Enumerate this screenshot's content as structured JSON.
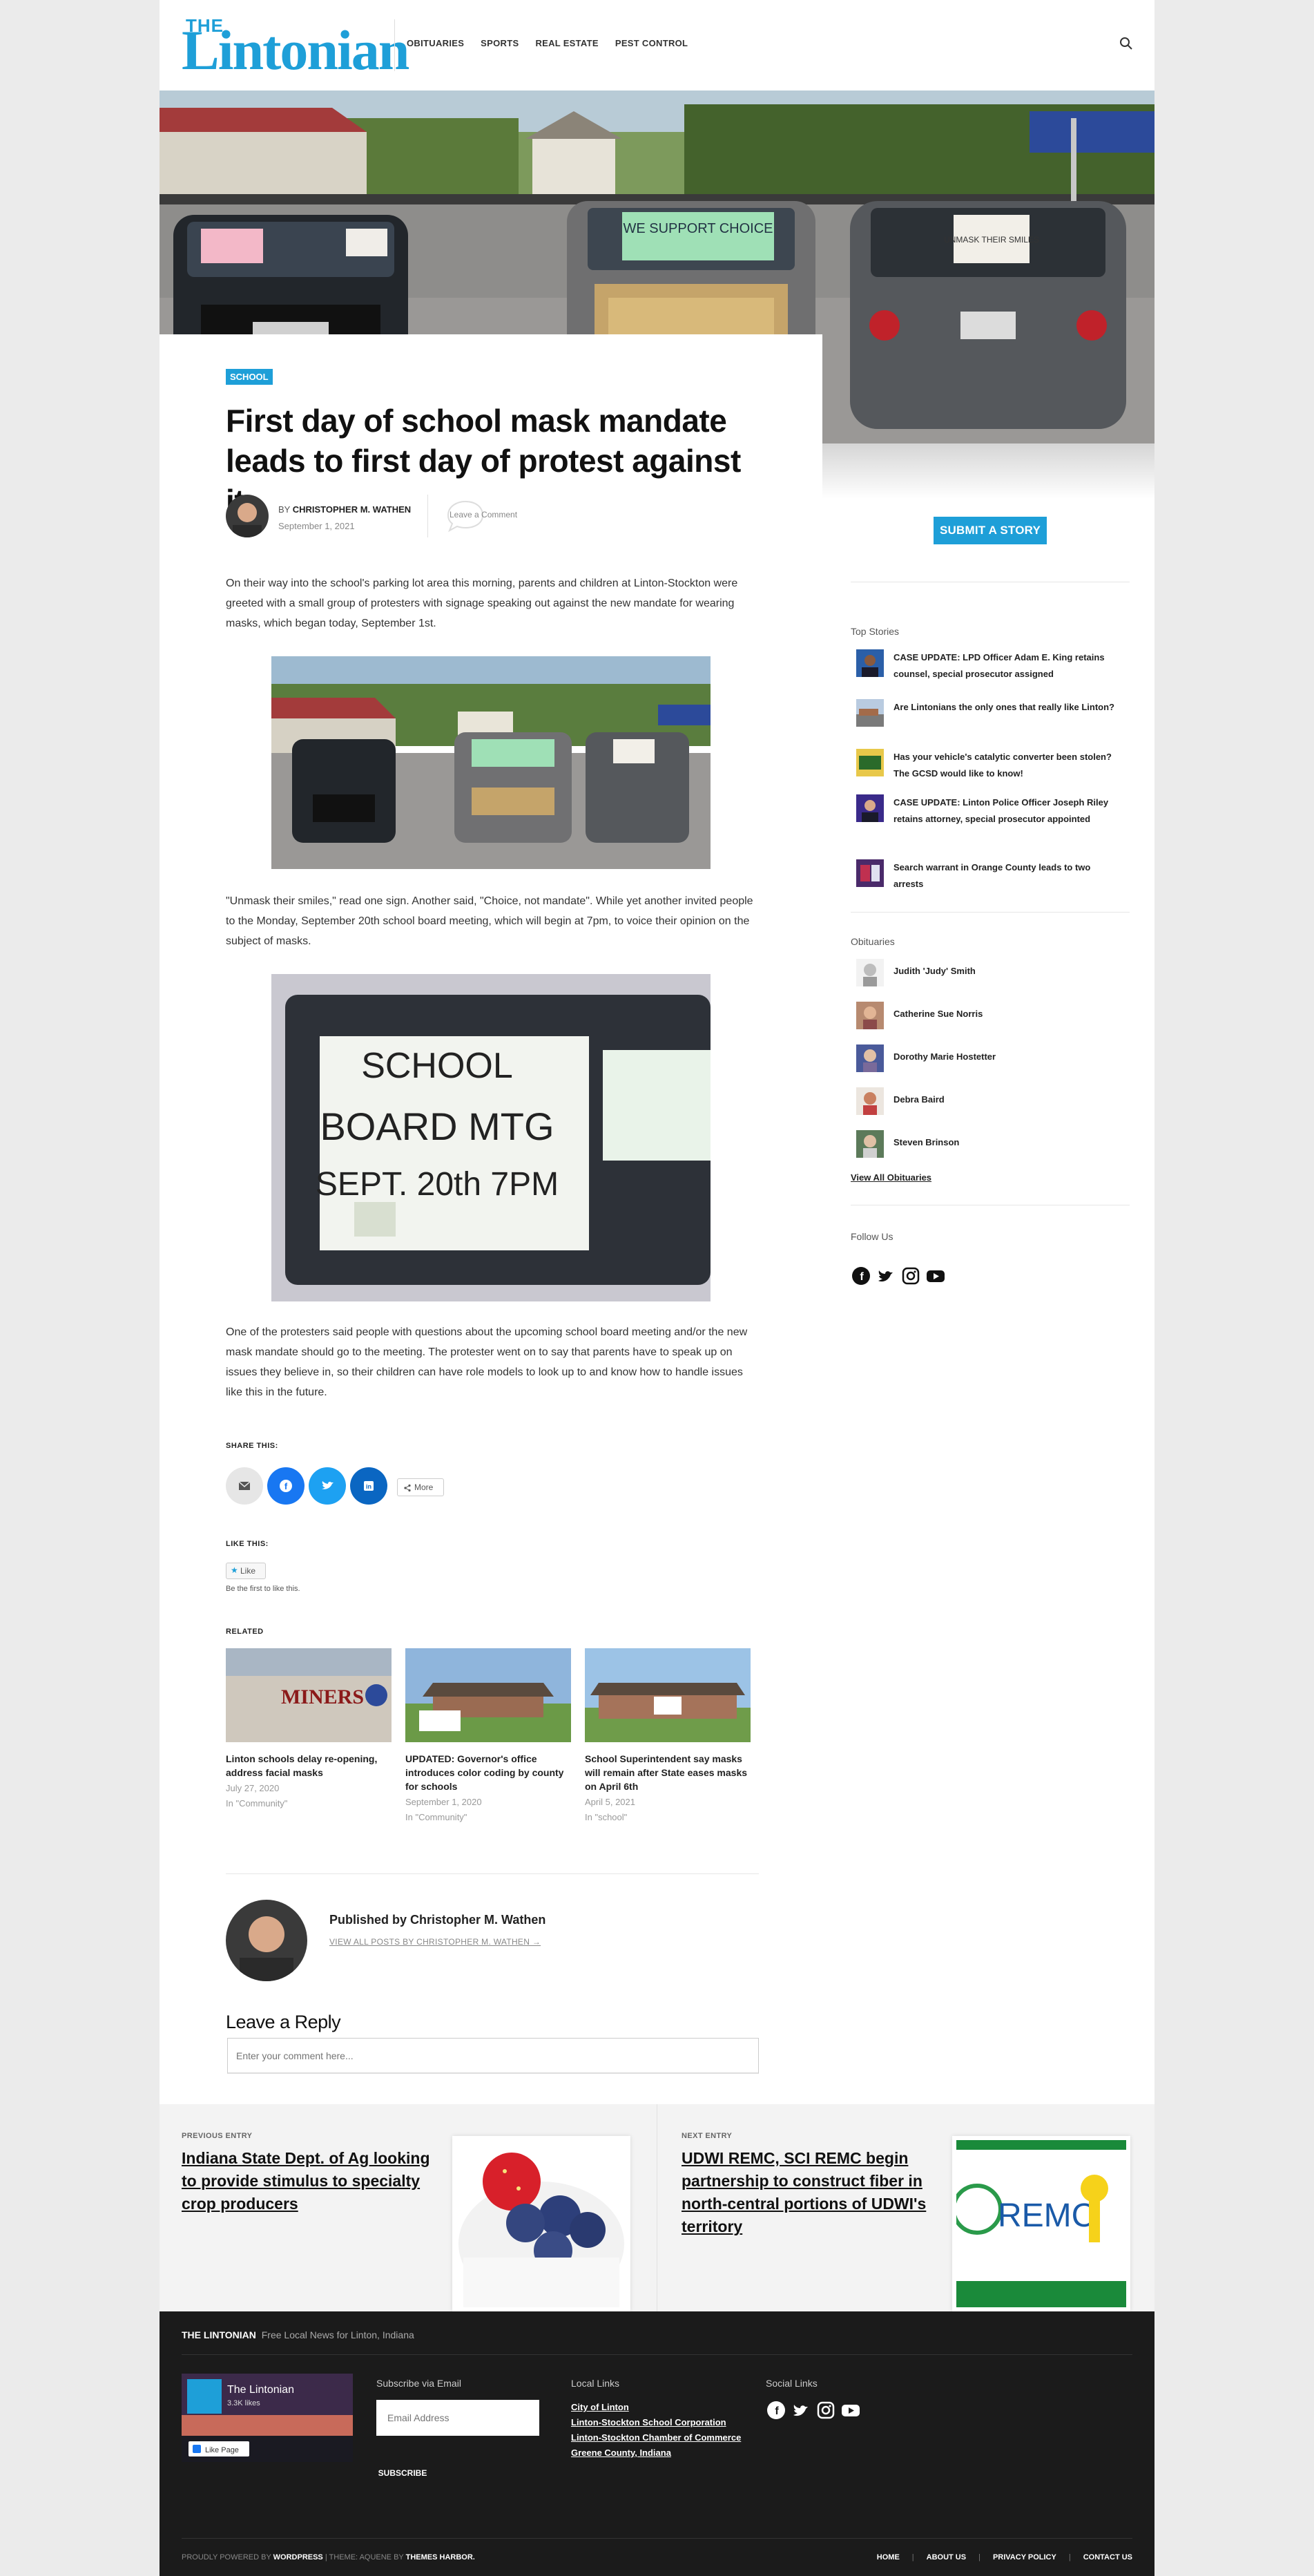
{
  "site": {
    "logo_small": "THE",
    "logo_name": "Lintonian",
    "nav": [
      "OBITUARIES",
      "SPORTS",
      "REAL ESTATE",
      "PEST CONTROL"
    ]
  },
  "hero": {
    "signs": [
      "UNMASK THEIR SMILES",
      "WE SUPPORT CHOICE"
    ]
  },
  "article": {
    "category": "SCHOOL",
    "title": "First day of school mask mandate leads to first day of protest against it",
    "by_prefix": "BY",
    "author": "CHRISTOPHER M. WATHEN",
    "date": "September 1, 2021",
    "comment_link": "Leave a Comment",
    "p1": "On their way into the school's parking lot area this morning, parents and children at Linton-Stockton were greeted with a small group of protesters with signage speaking out against the new mandate for wearing masks, which began today, September 1st.",
    "p2": "\"Unmask their smiles,\" read one sign. Another said, \"Choice, not mandate\". While yet another invited people to the Monday, September 20th school board meeting, which will begin at 7pm, to voice their opinion on the subject of masks.",
    "image2_sign": [
      "SCHOOL",
      "BOARD MTG",
      "SEPT. 20th 7PM"
    ],
    "p3": "One of the protesters said people with questions about the upcoming school board meeting and/or the new mask mandate should go to the meeting. The protester went on to say that parents have to speak up on issues they believe in, so their children can have role models to look up to and know how to handle issues like this in the future.",
    "share_label": "SHARE THIS:",
    "more_label": "More",
    "like_label": "LIKE THIS:",
    "like_button": "Like",
    "like_first": "Be the first to like this.",
    "related_label": "RELATED",
    "related": [
      {
        "title": "Linton schools delay re-opening, address facial masks",
        "date": "July 27, 2020",
        "category": "In \"Community\"",
        "thumb_text": "MINERS"
      },
      {
        "title": "UPDATED: Governor's office introduces color coding by county for schools",
        "date": "September 1, 2020",
        "category": "In \"Community\""
      },
      {
        "title": "School Superintendent say masks will remain after State eases masks on April 6th",
        "date": "April 5, 2021",
        "category": "In \"school\""
      }
    ],
    "published_by": "Published by Christopher M. Wathen",
    "view_all_posts": "VIEW ALL POSTS BY CHRISTOPHER M. WATHEN →",
    "reply_heading": "Leave a Reply",
    "comment_placeholder": "Enter your comment here..."
  },
  "sidebar": {
    "submit_story": "SUBMIT A STORY",
    "top_stories_heading": "Top Stories",
    "top_stories": [
      "CASE UPDATE: LPD Officer Adam E. King retains counsel, special prosecutor assigned",
      "Are Lintonians the only ones that really like Linton?",
      "Has your vehicle's catalytic converter been stolen? The GCSD would like to know!",
      "CASE UPDATE: Linton Police Officer Joseph Riley retains attorney, special prosecutor appointed",
      "Search warrant in Orange County leads to two arrests"
    ],
    "obituaries_heading": "Obituaries",
    "obituaries": [
      "Judith 'Judy' Smith",
      "Catherine Sue Norris",
      "Dorothy Marie Hostetter",
      "Debra Baird",
      "Steven Brinson"
    ],
    "view_all_obits": "View All Obituaries",
    "follow_heading": "Follow Us"
  },
  "post_nav": {
    "prev_label": "PREVIOUS ENTRY",
    "prev_title": "Indiana State Dept. of Ag looking to provide stimulus to specialty crop producers",
    "next_label": "NEXT ENTRY",
    "next_title": "UDWI REMC, SCI REMC begin partnership to construct fiber in north-central portions of UDWI's territory",
    "next_thumb_text": "REMC"
  },
  "footer": {
    "brand": "THE LINTONIAN",
    "tagline": "Free Local News for Linton, Indiana",
    "fb_page_name": "The Lintonian",
    "fb_followers": "3.3K likes",
    "fb_like_page": "Like Page",
    "subscribe_heading": "Subscribe via Email",
    "email_placeholder": "Email Address",
    "subscribe_button": "SUBSCRIBE",
    "local_links_heading": "Local Links",
    "local_links": [
      "City of Linton",
      "Linton-Stockton School Corporation",
      "Linton-Stockton Chamber of Commerce",
      "Greene County, Indiana"
    ],
    "social_links_heading": "Social Links",
    "powered_by": "PROUDLY POWERED BY",
    "wordpress": "WORDPRESS",
    "theme_text": "| THEME: AQUENE BY",
    "themes_harbor": "THEMES HARBOR.",
    "menu": [
      "HOME",
      "ABOUT US",
      "PRIVACY POLICY",
      "CONTACT US"
    ]
  },
  "colors": {
    "accent": "#1e9fd8",
    "email_share": "#e6e6e6",
    "facebook": "#1877f2",
    "twitter": "#1da1f2",
    "linkedin": "#0a66c2",
    "footer_bg": "#1b1b1b"
  }
}
